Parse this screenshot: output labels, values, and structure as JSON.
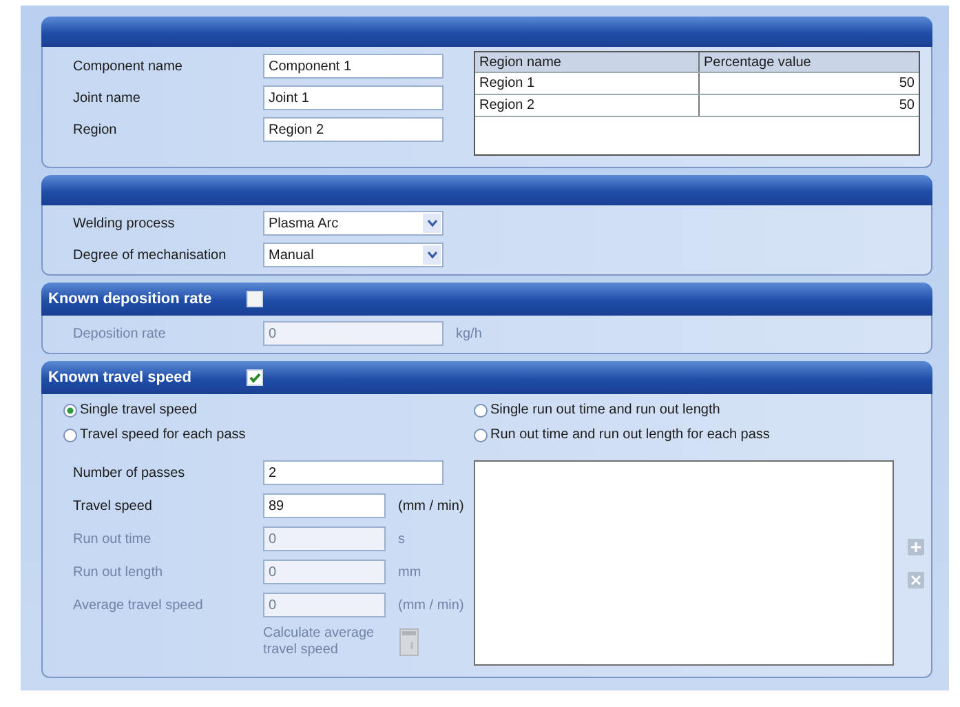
{
  "component": {
    "fields": [
      {
        "label": "Component name",
        "value": "Component 1"
      },
      {
        "label": "Joint name",
        "value": "Joint 1"
      },
      {
        "label": "Region",
        "value": "Region 2"
      }
    ],
    "region_table": {
      "columns": [
        "Region name",
        "Percentage value"
      ],
      "rows": [
        [
          "Region 1",
          "50"
        ],
        [
          "Region 2",
          "50"
        ]
      ]
    }
  },
  "process": {
    "fields": [
      {
        "label": "Welding process",
        "value": "Plasma Arc"
      },
      {
        "label": "Degree of mechanisation",
        "value": "Manual"
      }
    ]
  },
  "deposition": {
    "title": "Known deposition rate",
    "checked": false,
    "fields": [
      {
        "label": "Deposition rate",
        "value": "0",
        "unit": "kg/h",
        "disabled": true
      }
    ]
  },
  "travel": {
    "title": "Known travel speed",
    "checked": true,
    "speed_options": [
      {
        "label": "Single travel speed",
        "selected": true
      },
      {
        "label": "Travel speed for each pass",
        "selected": false
      }
    ],
    "runout_options": [
      {
        "label": "Single run out time and run out length",
        "selected": false
      },
      {
        "label": "Run out time and run out length for each pass",
        "selected": false
      }
    ],
    "fields": [
      {
        "label": "Number of passes",
        "value": "2",
        "disabled": false,
        "wide": true
      },
      {
        "label": "Travel speed",
        "value": "89",
        "unit": "(mm / min)",
        "disabled": false
      },
      {
        "label": "Run out time",
        "value": "0",
        "unit": "s",
        "disabled": true
      },
      {
        "label": "Run out length",
        "value": "0",
        "unit": "mm",
        "disabled": true
      },
      {
        "label": "Average travel speed",
        "value": "0",
        "unit": "(mm / min)",
        "disabled": true
      }
    ],
    "calculate": {
      "label": "Calculate average travel speed",
      "disabled": true
    },
    "list_buttons": {
      "disabled": true
    }
  }
}
